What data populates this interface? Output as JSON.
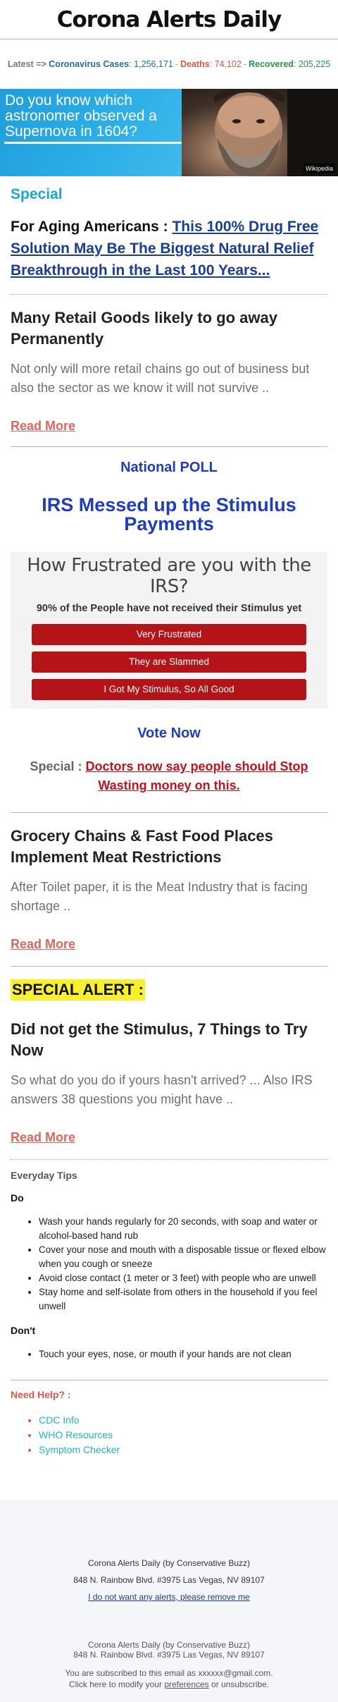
{
  "header": {
    "title": "Corona Alerts Daily"
  },
  "ticker": {
    "latest": "Latest =>",
    "cases_label": "Coronavirus Cases",
    "cases_value": "1,256,171",
    "deaths_label": "Deaths",
    "deaths_value": "74,102",
    "recovered_label": "Recovered",
    "recovered_value": "205,225"
  },
  "banner": {
    "text": "Do you know which astronomer observed a Supernova in 1604?",
    "caption": "Wikipedia"
  },
  "special": {
    "title": "Special",
    "prefix": "For Aging Americans :",
    "link": "This 100% Drug Free Solution May Be The Biggest Natural Relief Breakthrough in the Last 100 Years..."
  },
  "article1": {
    "title": "Many Retail Goods likely to go away Permanently",
    "body": "Not only will more retail chains go out of business but also the sector as we know it will not survive ..",
    "read_more": "Read More"
  },
  "poll": {
    "label": "National POLL",
    "headline": "IRS Messed up the Stimulus Payments",
    "question": "How Frustrated are you with the IRS?",
    "subtitle": "90% of the People have not received their Stimulus yet",
    "options": [
      "Very Frustrated",
      "They are Slammed",
      "I Got My Stimulus, So All Good"
    ],
    "vote_now": "Vote Now",
    "special_prefix": "Special :",
    "special_link": "Doctors now say people should Stop Wasting money on this."
  },
  "article2": {
    "title": "Grocery Chains & Fast Food Places Implement Meat Restrictions",
    "body": "After Toilet paper, it is the Meat Industry that is facing shortage ..",
    "read_more": "Read More"
  },
  "alert": {
    "label": "SPECIAL ALERT :"
  },
  "article3": {
    "title": "Did not get the Stimulus, 7 Things to Try Now",
    "body": "So what do you do if yours hasn't arrived? ... Also IRS answers 38 questions you might have ..",
    "read_more": "Read More"
  },
  "tips": {
    "title": "Everyday Tips",
    "do_label": "Do",
    "do_items": [
      "Wash your hands regularly for 20 seconds, with soap and water or alcohol-based hand rub",
      "Cover your nose and mouth with a disposable tissue or flexed elbow when you cough or sneeze",
      "Avoid close contact (1 meter or 3 feet) with people who are unwell",
      "Stay home and self-isolate from others in the household if you feel unwell"
    ],
    "dont_label": "Don't",
    "dont_items": [
      "Touch your eyes, nose, or mouth if your hands are not clean"
    ]
  },
  "help": {
    "title": "Need Help? :",
    "links": [
      "CDC Info",
      "WHO Resources",
      "Symptom Checker"
    ]
  },
  "footer": {
    "org": "Corona Alerts Daily (by Conservative Buzz)",
    "address": "848 N. Rainbow Blvd. #3975 Las Vegas, NV 89107",
    "unsubscribe": "I do not want any alerts, please remove me",
    "org2": "Corona Alerts Daily (by Conservative Buzz)",
    "address2": "848 N. Rainbow Blvd. #3975 Las Vegas, NV 89107",
    "subscribed": "You are subscribed to this email as xxxxxx@gmail.com.",
    "modify_prefix": "Click here to modify your",
    "preferences": "preferences",
    "modify_suffix": "or unsubscribe."
  }
}
